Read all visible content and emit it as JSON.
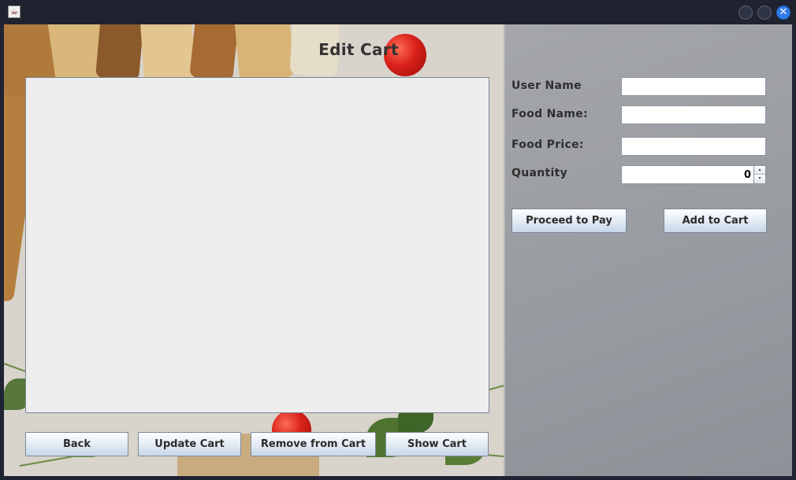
{
  "window": {
    "title": "",
    "app_icon": "java-app-icon",
    "controls": {
      "minimize_icon": "minimize-icon",
      "maximize_icon": "maximize-icon",
      "close_icon": "close-icon",
      "close_glyph": "✕"
    }
  },
  "page": {
    "title": "Edit Cart"
  },
  "cart_list": {
    "items": []
  },
  "form": {
    "user_name": {
      "label": "User Name",
      "value": ""
    },
    "food_name": {
      "label": "Food Name:",
      "value": ""
    },
    "food_price": {
      "label": "Food Price:",
      "value": ""
    },
    "quantity": {
      "label": "Quantity",
      "value": "0",
      "up_glyph": "▴",
      "down_glyph": "▾"
    }
  },
  "buttons": {
    "proceed": "Proceed to Pay",
    "add": "Add to Cart",
    "back": "Back",
    "update": "Update Cart",
    "remove": "Remove from Cart",
    "show": "Show Cart"
  },
  "colors": {
    "titlebar": "#20232f",
    "close_button": "#2f7bea",
    "button_gradient_bottom": "#c7d7e8",
    "list_background": "#eeeeee"
  }
}
